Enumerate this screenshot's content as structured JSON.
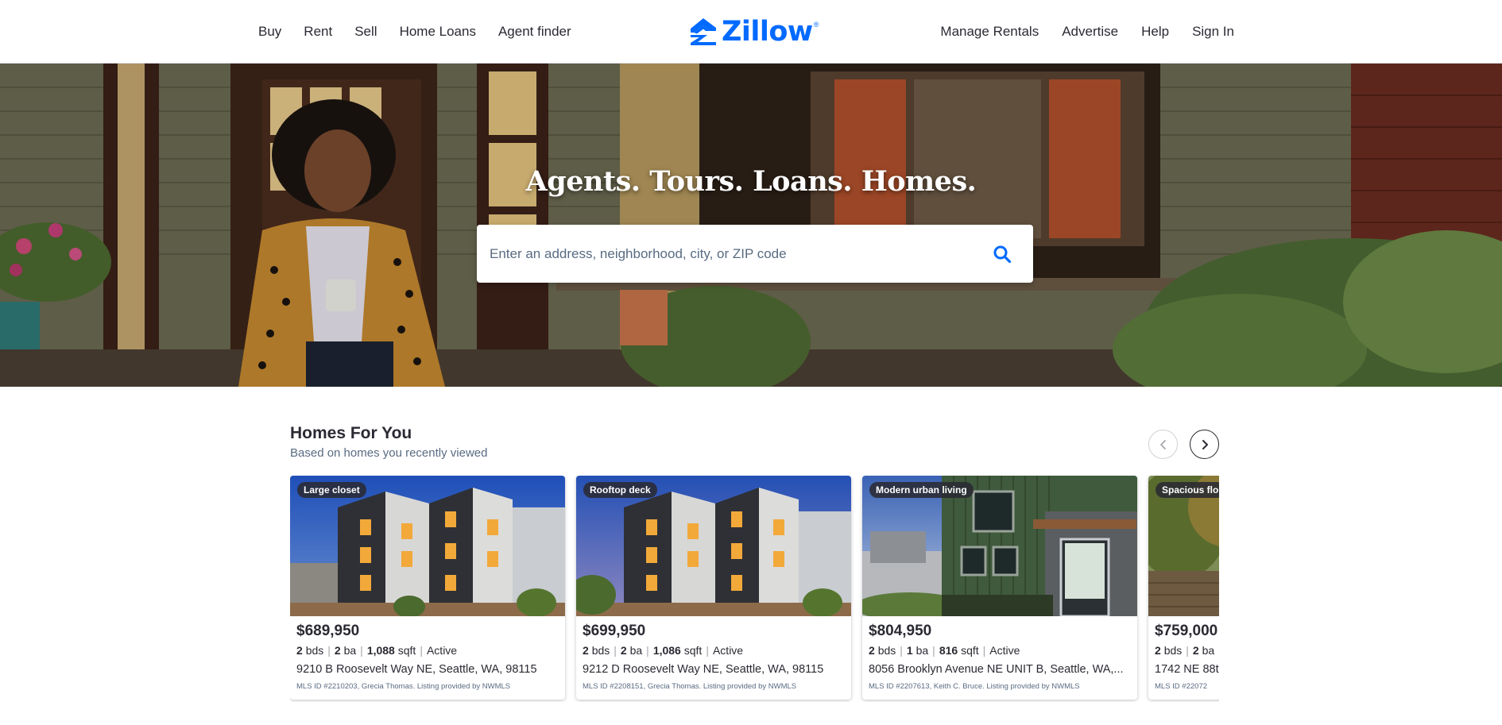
{
  "header": {
    "nav_left": [
      "Buy",
      "Rent",
      "Sell",
      "Home Loans",
      "Agent finder"
    ],
    "logo_text": "Zillow",
    "logo_mark": "®",
    "nav_right": [
      "Manage Rentals",
      "Advertise",
      "Help",
      "Sign In"
    ]
  },
  "hero": {
    "title": "Agents. Tours. Loans. Homes.",
    "search_placeholder": "Enter an address, neighborhood, city, or ZIP code",
    "search_icon": "search-icon"
  },
  "homes_for_you": {
    "title": "Homes For You",
    "subtitle": "Based on homes you recently viewed",
    "prev_icon": "chevron-left-icon",
    "next_icon": "chevron-right-icon",
    "cards": [
      {
        "badge": "Large closet",
        "price": "$689,950",
        "beds": "2",
        "beds_unit": "bds",
        "baths": "2",
        "baths_unit": "ba",
        "sqft": "1,088",
        "sqft_unit": "sqft",
        "status": "Active",
        "address": "9210 B Roosevelt Way NE, Seattle, WA, 98115",
        "mls": "MLS ID #2210203, Grecia Thomas. Listing provided by NWMLS"
      },
      {
        "badge": "Rooftop deck",
        "price": "$699,950",
        "beds": "2",
        "beds_unit": "bds",
        "baths": "2",
        "baths_unit": "ba",
        "sqft": "1,086",
        "sqft_unit": "sqft",
        "status": "Active",
        "address": "9212 D Roosevelt Way NE, Seattle, WA, 98115",
        "mls": "MLS ID #2208151, Grecia Thomas. Listing provided by NWMLS"
      },
      {
        "badge": "Modern urban living",
        "price": "$804,950",
        "beds": "2",
        "beds_unit": "bds",
        "baths": "1",
        "baths_unit": "ba",
        "sqft": "816",
        "sqft_unit": "sqft",
        "status": "Active",
        "address": "8056 Brooklyn Avenue NE UNIT B, Seattle, WA,...",
        "mls": "MLS ID #2207613, Keith C. Bruce. Listing provided by NWMLS"
      },
      {
        "badge": "Spacious flo",
        "price": "$759,000",
        "beds": "2",
        "beds_unit": "bds",
        "baths": "2",
        "baths_unit": "ba",
        "sqft": "",
        "sqft_unit": "",
        "status": "",
        "address": "1742 NE 88th",
        "mls": "MLS ID #22072"
      }
    ]
  },
  "colors": {
    "brand": "#006aff",
    "text": "#2a2a33",
    "muted": "#596b82"
  }
}
